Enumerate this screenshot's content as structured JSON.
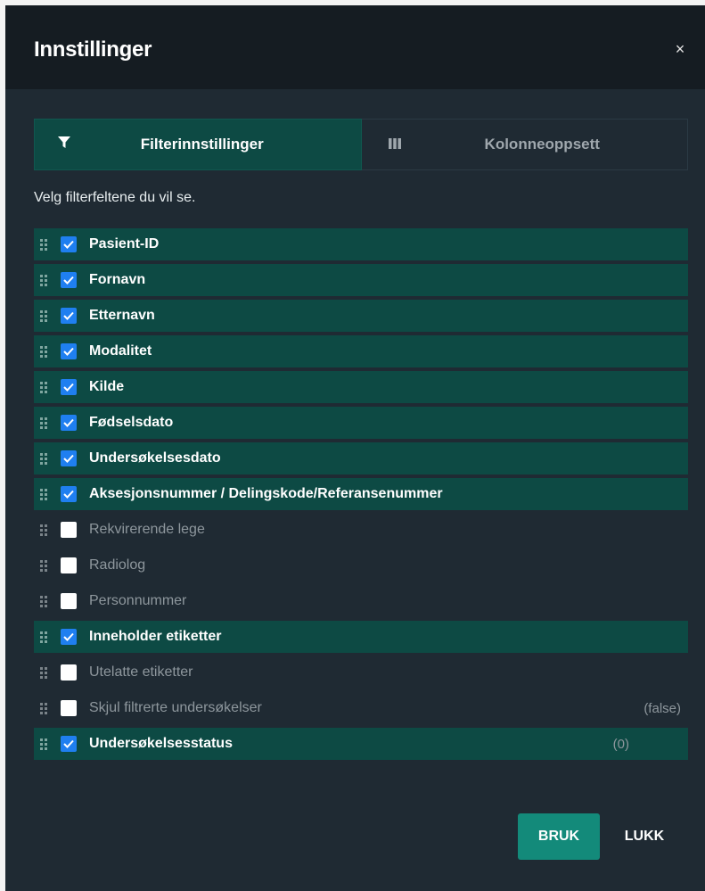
{
  "dialog": {
    "title": "Innstillinger",
    "close_glyph": "×"
  },
  "tabs": [
    {
      "label": "Filterinnstillinger",
      "icon": "filter-icon",
      "active": true
    },
    {
      "label": "Kolonneoppsett",
      "icon": "columns-icon",
      "active": false
    }
  ],
  "instructions": "Velg filterfeltene du vil se.",
  "fields": [
    {
      "label": "Pasient-ID",
      "checked": true,
      "extra": ""
    },
    {
      "label": "Fornavn",
      "checked": true,
      "extra": ""
    },
    {
      "label": "Etternavn",
      "checked": true,
      "extra": ""
    },
    {
      "label": "Modalitet",
      "checked": true,
      "extra": ""
    },
    {
      "label": "Kilde",
      "checked": true,
      "extra": ""
    },
    {
      "label": "Fødselsdato",
      "checked": true,
      "extra": ""
    },
    {
      "label": "Undersøkelsesdato",
      "checked": true,
      "extra": ""
    },
    {
      "label": "Aksesjonsnummer / Delingskode/Referansenummer",
      "checked": true,
      "extra": ""
    },
    {
      "label": "Rekvirerende lege",
      "checked": false,
      "extra": ""
    },
    {
      "label": "Radiolog",
      "checked": false,
      "extra": ""
    },
    {
      "label": "Personnummer",
      "checked": false,
      "extra": ""
    },
    {
      "label": "Inneholder etiketter",
      "checked": true,
      "extra": ""
    },
    {
      "label": "Utelatte etiketter",
      "checked": false,
      "extra": ""
    },
    {
      "label": "Skjul filtrerte undersøkelser",
      "checked": false,
      "extra": "(false)"
    },
    {
      "label": "Undersøkelsesstatus",
      "checked": true,
      "extra": "(0)"
    }
  ],
  "footer": {
    "apply_label": "BRUK",
    "close_label": "LUKK"
  },
  "colors": {
    "dialog_bg": "#1f2a33",
    "header_bg": "#151c22",
    "checked_row_bg": "#0d4a44",
    "checkbox_checked": "#1f7ff0",
    "apply_button": "#138a7a"
  }
}
